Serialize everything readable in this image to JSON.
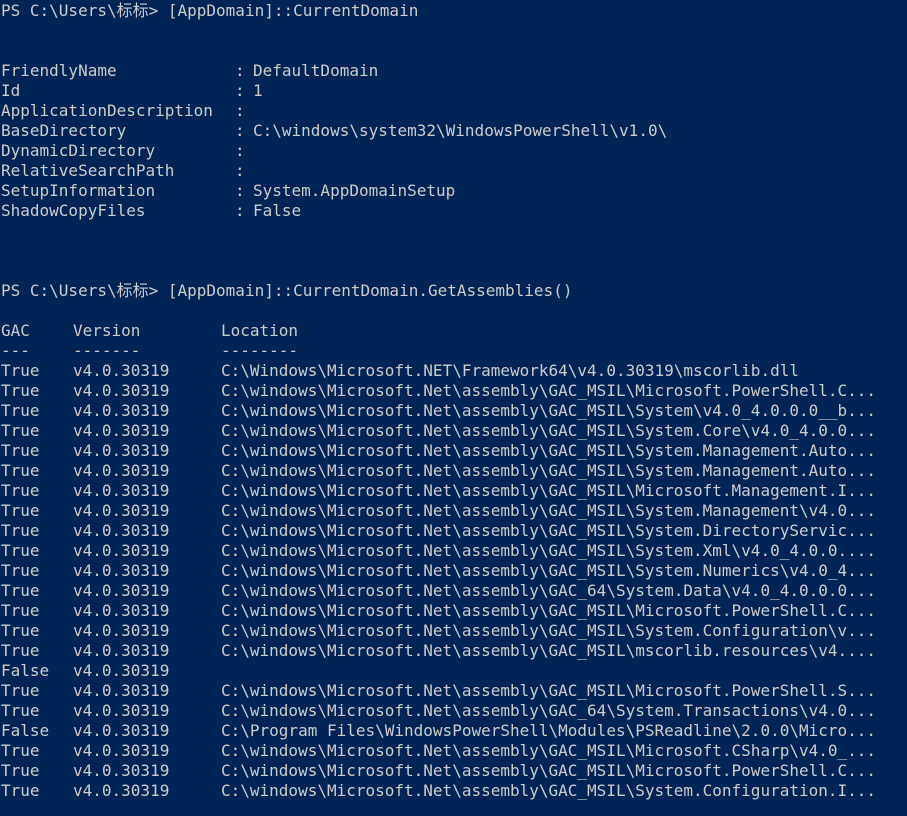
{
  "terminal": {
    "app_title": "Windows PowerShell",
    "background_color": "#012456",
    "foreground_color": "#cccccc",
    "prompt_prefix": "PS C:\\Users\\标标>"
  },
  "session": {
    "command_1": {
      "prompt": "PS C:\\Users\\标标>",
      "command": "[AppDomain]::CurrentDomain"
    },
    "command_2": {
      "prompt": "PS C:\\Users\\标标>",
      "command": "[AppDomain]::CurrentDomain.GetAssemblies()"
    }
  },
  "appdomain_properties": {
    "separator": ":",
    "items": [
      {
        "name": "FriendlyName",
        "value": "DefaultDomain"
      },
      {
        "name": "Id",
        "value": "1"
      },
      {
        "name": "ApplicationDescription",
        "value": ""
      },
      {
        "name": "BaseDirectory",
        "value": "C:\\windows\\system32\\WindowsPowerShell\\v1.0\\"
      },
      {
        "name": "DynamicDirectory",
        "value": ""
      },
      {
        "name": "RelativeSearchPath",
        "value": ""
      },
      {
        "name": "SetupInformation",
        "value": "System.AppDomainSetup"
      },
      {
        "name": "ShadowCopyFiles",
        "value": "False"
      }
    ]
  },
  "assemblies_table": {
    "headers": {
      "gac": "GAC",
      "version": "Version",
      "location": "Location"
    },
    "header_underlines": {
      "gac": "---",
      "version": "-------",
      "location": "--------"
    },
    "rows": [
      {
        "gac": "True",
        "version": "v4.0.30319",
        "location": "C:\\Windows\\Microsoft.NET\\Framework64\\v4.0.30319\\mscorlib.dll"
      },
      {
        "gac": "True",
        "version": "v4.0.30319",
        "location": "C:\\windows\\Microsoft.Net\\assembly\\GAC_MSIL\\Microsoft.PowerShell.C..."
      },
      {
        "gac": "True",
        "version": "v4.0.30319",
        "location": "C:\\windows\\Microsoft.Net\\assembly\\GAC_MSIL\\System\\v4.0_4.0.0.0__b..."
      },
      {
        "gac": "True",
        "version": "v4.0.30319",
        "location": "C:\\windows\\Microsoft.Net\\assembly\\GAC_MSIL\\System.Core\\v4.0_4.0.0..."
      },
      {
        "gac": "True",
        "version": "v4.0.30319",
        "location": "C:\\windows\\Microsoft.Net\\assembly\\GAC_MSIL\\System.Management.Auto..."
      },
      {
        "gac": "True",
        "version": "v4.0.30319",
        "location": "C:\\windows\\Microsoft.Net\\assembly\\GAC_MSIL\\System.Management.Auto..."
      },
      {
        "gac": "True",
        "version": "v4.0.30319",
        "location": "C:\\windows\\Microsoft.Net\\assembly\\GAC_MSIL\\Microsoft.Management.I..."
      },
      {
        "gac": "True",
        "version": "v4.0.30319",
        "location": "C:\\windows\\Microsoft.Net\\assembly\\GAC_MSIL\\System.Management\\v4.0..."
      },
      {
        "gac": "True",
        "version": "v4.0.30319",
        "location": "C:\\windows\\Microsoft.Net\\assembly\\GAC_MSIL\\System.DirectoryServic..."
      },
      {
        "gac": "True",
        "version": "v4.0.30319",
        "location": "C:\\windows\\Microsoft.Net\\assembly\\GAC_MSIL\\System.Xml\\v4.0_4.0.0...."
      },
      {
        "gac": "True",
        "version": "v4.0.30319",
        "location": "C:\\windows\\Microsoft.Net\\assembly\\GAC_MSIL\\System.Numerics\\v4.0_4..."
      },
      {
        "gac": "True",
        "version": "v4.0.30319",
        "location": "C:\\windows\\Microsoft.Net\\assembly\\GAC_64\\System.Data\\v4.0_4.0.0.0..."
      },
      {
        "gac": "True",
        "version": "v4.0.30319",
        "location": "C:\\windows\\Microsoft.Net\\assembly\\GAC_MSIL\\Microsoft.PowerShell.C..."
      },
      {
        "gac": "True",
        "version": "v4.0.30319",
        "location": "C:\\windows\\Microsoft.Net\\assembly\\GAC_MSIL\\System.Configuration\\v..."
      },
      {
        "gac": "True",
        "version": "v4.0.30319",
        "location": "C:\\windows\\Microsoft.Net\\assembly\\GAC_MSIL\\mscorlib.resources\\v4...."
      },
      {
        "gac": "False",
        "version": "v4.0.30319",
        "location": ""
      },
      {
        "gac": "True",
        "version": "v4.0.30319",
        "location": "C:\\windows\\Microsoft.Net\\assembly\\GAC_MSIL\\Microsoft.PowerShell.S..."
      },
      {
        "gac": "True",
        "version": "v4.0.30319",
        "location": "C:\\windows\\Microsoft.Net\\assembly\\GAC_64\\System.Transactions\\v4.0..."
      },
      {
        "gac": "False",
        "version": "v4.0.30319",
        "location": "C:\\Program Files\\WindowsPowerShell\\Modules\\PSReadline\\2.0.0\\Micro..."
      },
      {
        "gac": "True",
        "version": "v4.0.30319",
        "location": "C:\\windows\\Microsoft.Net\\assembly\\GAC_MSIL\\Microsoft.CSharp\\v4.0_..."
      },
      {
        "gac": "True",
        "version": "v4.0.30319",
        "location": "C:\\windows\\Microsoft.Net\\assembly\\GAC_MSIL\\Microsoft.PowerShell.C..."
      },
      {
        "gac": "True",
        "version": "v4.0.30319",
        "location": "C:\\windows\\Microsoft.Net\\assembly\\GAC_MSIL\\System.Configuration.I..."
      }
    ]
  }
}
